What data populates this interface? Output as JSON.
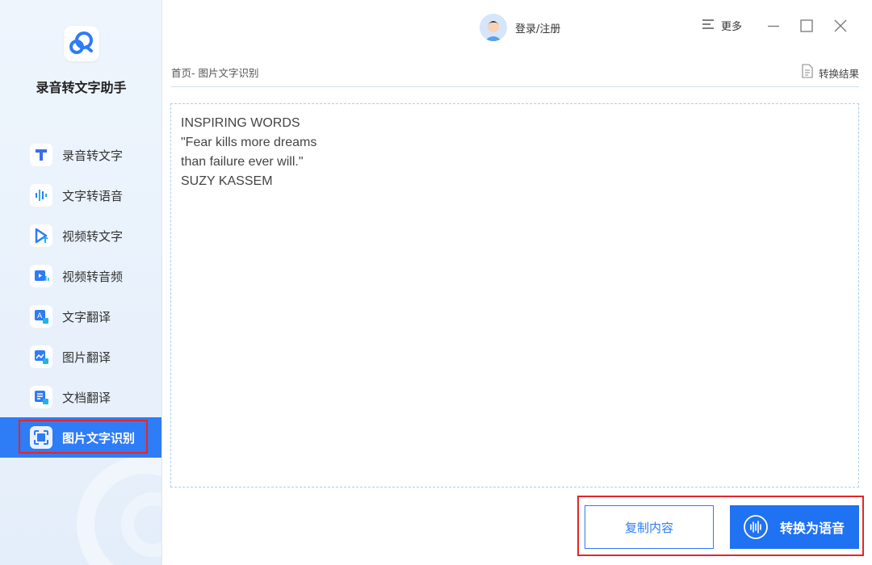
{
  "app": {
    "name": "录音转文字助手"
  },
  "header": {
    "login_label": "登录/注册",
    "more_label": "更多"
  },
  "sidebar": {
    "items": [
      {
        "label": "录音转文字",
        "icon": "t-letter-icon"
      },
      {
        "label": "文字转语音",
        "icon": "waveform-icon"
      },
      {
        "label": "视频转文字",
        "icon": "video-text-icon"
      },
      {
        "label": "视频转音频",
        "icon": "video-audio-icon"
      },
      {
        "label": "文字翻译",
        "icon": "text-translate-icon"
      },
      {
        "label": "图片翻译",
        "icon": "image-translate-icon"
      },
      {
        "label": "文档翻译",
        "icon": "document-translate-icon"
      },
      {
        "label": "图片文字识别",
        "icon": "scan-icon",
        "active": true
      }
    ]
  },
  "breadcrumb": {
    "text": "首页- 图片文字识别"
  },
  "result_link": {
    "label": "转换结果"
  },
  "content": {
    "lines": [
      "INSPIRING WORDS",
      "\"Fear kills more dreams",
      "than failure ever will.\"",
      "SUZY KASSEM"
    ]
  },
  "actions": {
    "copy_label": "复制内容",
    "convert_label": "转换为语音"
  },
  "colors": {
    "accent": "#2e7cf6",
    "highlight_outline": "#e5252a"
  }
}
